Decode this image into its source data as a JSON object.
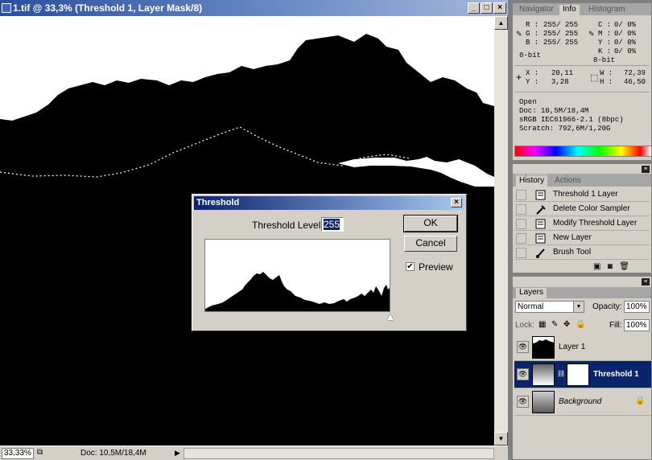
{
  "document": {
    "title": "1.tif @ 33,3% (Threshold 1, Layer Mask/8)",
    "zoom": "33,33%",
    "doc_size": "Doc: 10,5M/18,4M"
  },
  "threshold_dialog": {
    "title": "Threshold",
    "level_label": "Threshold Level:",
    "level_value": "255",
    "ok_label": "OK",
    "cancel_label": "Cancel",
    "preview_label": "Preview",
    "preview_checked": true
  },
  "info_panel": {
    "tabs": [
      "Navigator",
      "Info",
      "Histogram"
    ],
    "active_tab": "Info",
    "left_labels": [
      "R :",
      "G :",
      "B :"
    ],
    "left_values": [
      "255/ 255",
      "255/ 255",
      "255/ 255"
    ],
    "left_mode": "8-bit",
    "right_labels": [
      "C :",
      "M :",
      "Y :",
      "K :"
    ],
    "right_values": [
      "0/ 0%",
      "0/ 0%",
      "0/ 0%",
      "0/ 0%"
    ],
    "right_mode": "8-bit",
    "xy_labels": [
      "X :",
      "Y :"
    ],
    "xy_values": [
      "20,11",
      "3,28"
    ],
    "wh_labels": [
      "W :",
      "H :"
    ],
    "wh_values": [
      "72,39",
      "46,50"
    ],
    "status_lines": [
      "Open",
      "Doc: 10,5M/18,4M",
      "sRGB IEC61966-2.1 (8bpc)",
      "Scratch: 792,6M/1,20G"
    ]
  },
  "history_panel": {
    "tabs": [
      "History",
      "Actions"
    ],
    "active_tab": "History",
    "items": [
      {
        "label": "Threshold 1 Layer",
        "icon": "layer-doc-icon"
      },
      {
        "label": "Delete Color Sampler",
        "icon": "color-sampler-icon"
      },
      {
        "label": "Modify Threshold Layer",
        "icon": "layer-doc-icon"
      },
      {
        "label": "New Layer",
        "icon": "layer-doc-icon"
      },
      {
        "label": "Brush Tool",
        "icon": "brush-icon"
      }
    ]
  },
  "layers_panel": {
    "tab": "Layers",
    "blend_mode": "Normal",
    "opacity_label": "Opacity:",
    "opacity_value": "100%",
    "lock_label": "Lock:",
    "fill_label": "Fill:",
    "fill_value": "100%",
    "layers": [
      {
        "name": "Layer 1",
        "selected": false
      },
      {
        "name": "Threshold 1",
        "selected": true
      },
      {
        "name": "Background",
        "selected": false
      }
    ]
  },
  "colors": {
    "selection": "#0a246a",
    "title_start": "#2a4fa0",
    "panel_bg": "#d4d0c8"
  }
}
